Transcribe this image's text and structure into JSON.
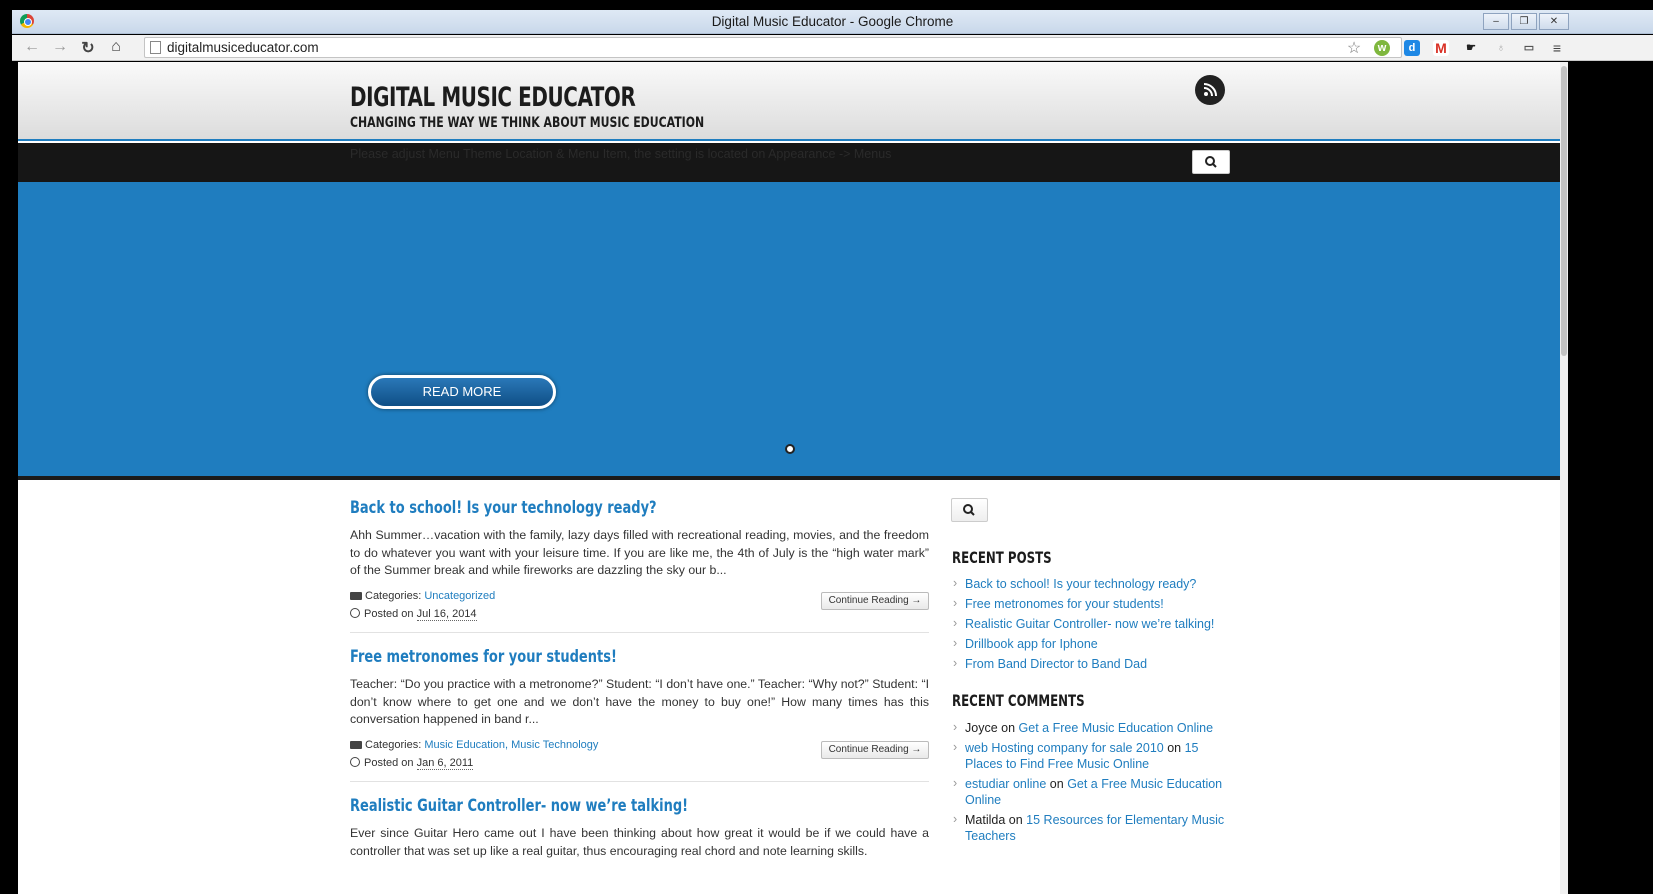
{
  "window": {
    "title": "Digital Music Educator - Google Chrome"
  },
  "browser": {
    "url": "digitalmusiceducator.com"
  },
  "site": {
    "title": "DIGITAL MUSIC EDUCATOR",
    "tagline": "CHANGING THE WAY WE THINK ABOUT MUSIC EDUCATION",
    "menu_notice": "Please adjust Menu Theme Location & Menu Item, the setting is located on Appearance -> Menus"
  },
  "hero": {
    "button_label": "READ MORE"
  },
  "posts": [
    {
      "title": "Back to school! Is your technology ready?",
      "excerpt": "Ahh Summer…vacation with the family, lazy days filled with recreational reading, movies, and the freedom to do whatever you want with your leisure time.  If you are like me, the 4th of July is the “high water mark” of the Summer break and while fireworks are dazzling the sky our b...",
      "categories_label": "Categories:",
      "categories": "Uncategorized",
      "posted_label": "Posted on",
      "date": "Jul 16, 2014",
      "continue_label": "Continue Reading →"
    },
    {
      "title": "Free metronomes for your students!",
      "excerpt": "Teacher:  “Do you practice with a metronome?” Student:  “I don’t have one.” Teacher: “Why not?” Student: “I don’t know where to get one and we don’t have the money to buy one!” How many times has this conversation happened in band r...",
      "categories_label": "Categories:",
      "categories": "Music Education, Music Technology",
      "posted_label": "Posted on",
      "date": "Jan 6, 2011",
      "continue_label": "Continue Reading →"
    },
    {
      "title": "Realistic Guitar Controller- now we’re talking!",
      "excerpt": "Ever since Guitar Hero came out I have been thinking about how great it would be if we could have a controller that was set up like a real guitar, thus encouraging real chord and note learning skills."
    }
  ],
  "sidebar": {
    "recent_posts_title": "RECENT POSTS",
    "recent_posts": [
      "Back to school! Is your technology ready?",
      "Free metronomes for your students!",
      "Realistic Guitar Controller- now we’re talking!",
      "Drillbook app for Iphone",
      "From Band Director to Band Dad"
    ],
    "recent_comments_title": "RECENT COMMENTS",
    "recent_comments": [
      {
        "author": "Joyce",
        "on": "on",
        "post": "Get a Free Music Education Online"
      },
      {
        "author": "web Hosting company for sale 2010",
        "on": "on",
        "post": "15 Places to Find Free Music Online"
      },
      {
        "author": "estudiar online",
        "on": "on",
        "post": "Get a Free Music Education Online"
      },
      {
        "author": "Matilda",
        "on": "on",
        "post": "15 Resources for Elementary Music Teachers"
      }
    ]
  },
  "colors": {
    "accent": "#1f7dbf",
    "menubar": "#161616",
    "hero": "#1f7dbf"
  }
}
